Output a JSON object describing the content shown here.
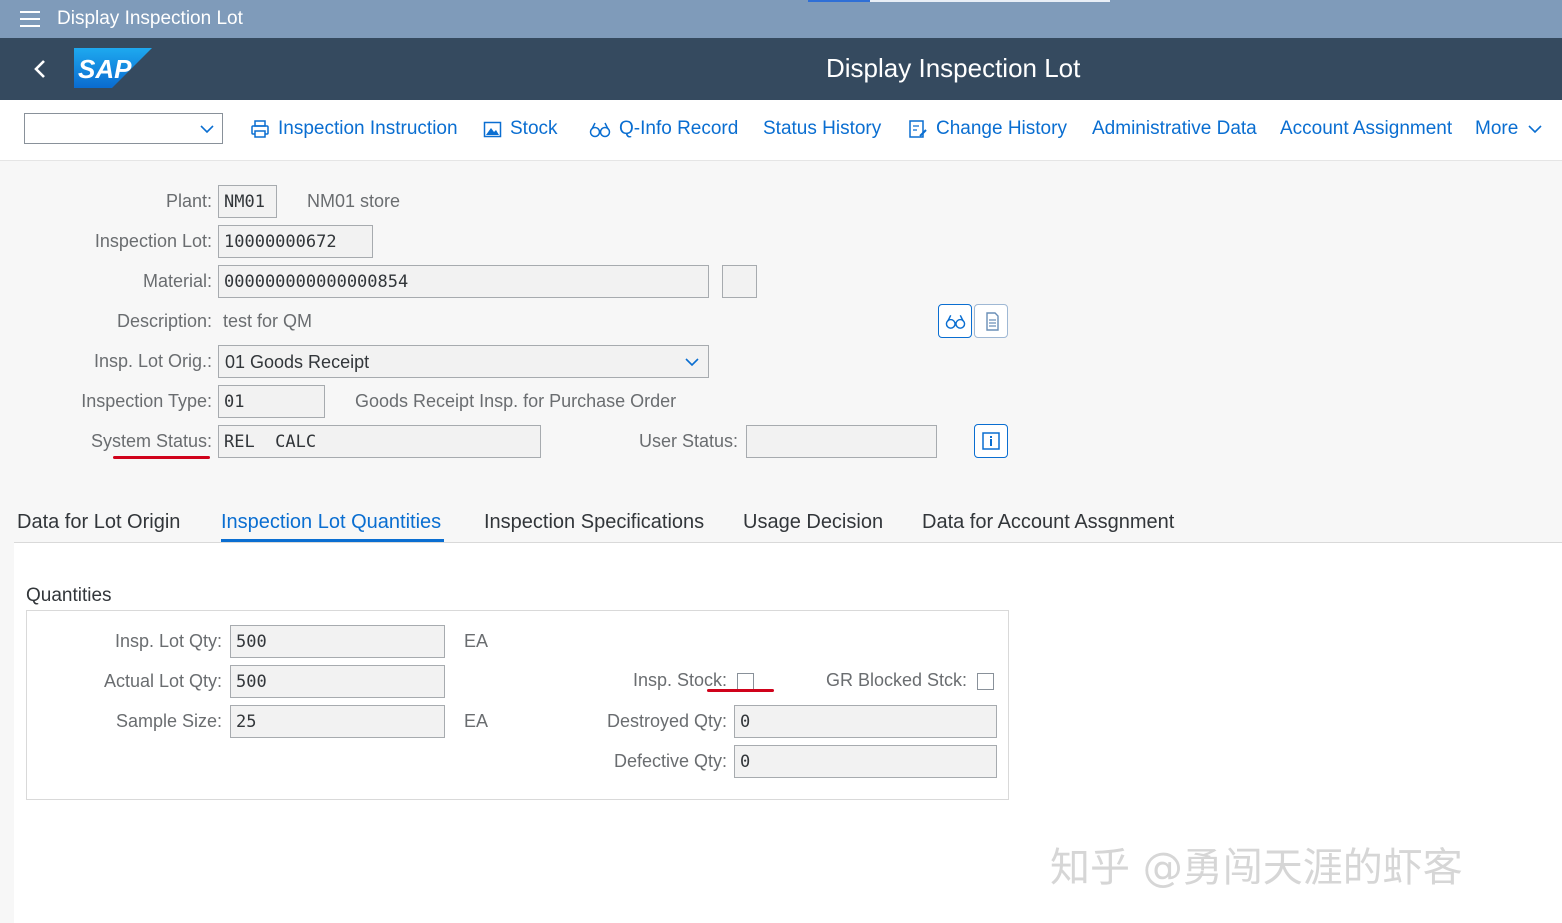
{
  "window": {
    "title": "Display Inspection Lot"
  },
  "shell": {
    "page_title": "Display Inspection Lot",
    "logo_text": "SAP"
  },
  "toolbar": {
    "items": [
      {
        "label": "Inspection Instruction",
        "icon": "printer-icon"
      },
      {
        "label": "Stock",
        "icon": "picture-icon"
      },
      {
        "label": "Q-Info Record",
        "icon": "glasses-icon"
      },
      {
        "label": "Status History",
        "icon": ""
      },
      {
        "label": "Change History",
        "icon": "change-history-icon"
      },
      {
        "label": "Administrative Data",
        "icon": ""
      },
      {
        "label": "Account Assignment",
        "icon": ""
      }
    ],
    "more_label": "More"
  },
  "header": {
    "plant_label": "Plant:",
    "plant_value": "NM01",
    "plant_desc": "NM01 store",
    "lot_label": "Inspection Lot:",
    "lot_value": "10000000672",
    "material_label": "Material:",
    "material_value": "000000000000000854",
    "description_label": "Description:",
    "description_value": "test for QM",
    "origin_label": "Insp. Lot Orig.:",
    "origin_value": "01 Goods Receipt",
    "type_label": "Inspection Type:",
    "type_value": "01",
    "type_desc": "Goods Receipt Insp. for Purchase Order",
    "system_status_label": "System Status:",
    "system_status_value": "REL  CALC",
    "user_status_label": "User Status:",
    "user_status_value": ""
  },
  "tabs": [
    {
      "label": "Data for Lot Origin",
      "active": false
    },
    {
      "label": "Inspection Lot Quantities",
      "active": true
    },
    {
      "label": "Inspection Specifications",
      "active": false
    },
    {
      "label": "Usage Decision",
      "active": false
    },
    {
      "label": "Data for Account Assgnment",
      "active": false
    }
  ],
  "quantities": {
    "title": "Quantities",
    "insp_lot_qty_label": "Insp. Lot Qty:",
    "insp_lot_qty_value": "500",
    "insp_lot_qty_unit": "EA",
    "actual_lot_qty_label": "Actual Lot Qty:",
    "actual_lot_qty_value": "500",
    "sample_size_label": "Sample Size:",
    "sample_size_value": "25",
    "sample_size_unit": "EA",
    "insp_stock_label": "Insp. Stock:",
    "insp_stock_checked": false,
    "gr_blocked_label": "GR Blocked Stck:",
    "gr_blocked_checked": false,
    "destroyed_qty_label": "Destroyed Qty:",
    "destroyed_qty_value": "0",
    "defective_qty_label": "Defective Qty:",
    "defective_qty_value": "0"
  },
  "watermark": "知乎 @勇闯天涯的虾客",
  "colors": {
    "shell": "#354a5f",
    "window_bar": "#7f9bba",
    "link": "#0a6ed1",
    "annotation": "#d0021b"
  }
}
